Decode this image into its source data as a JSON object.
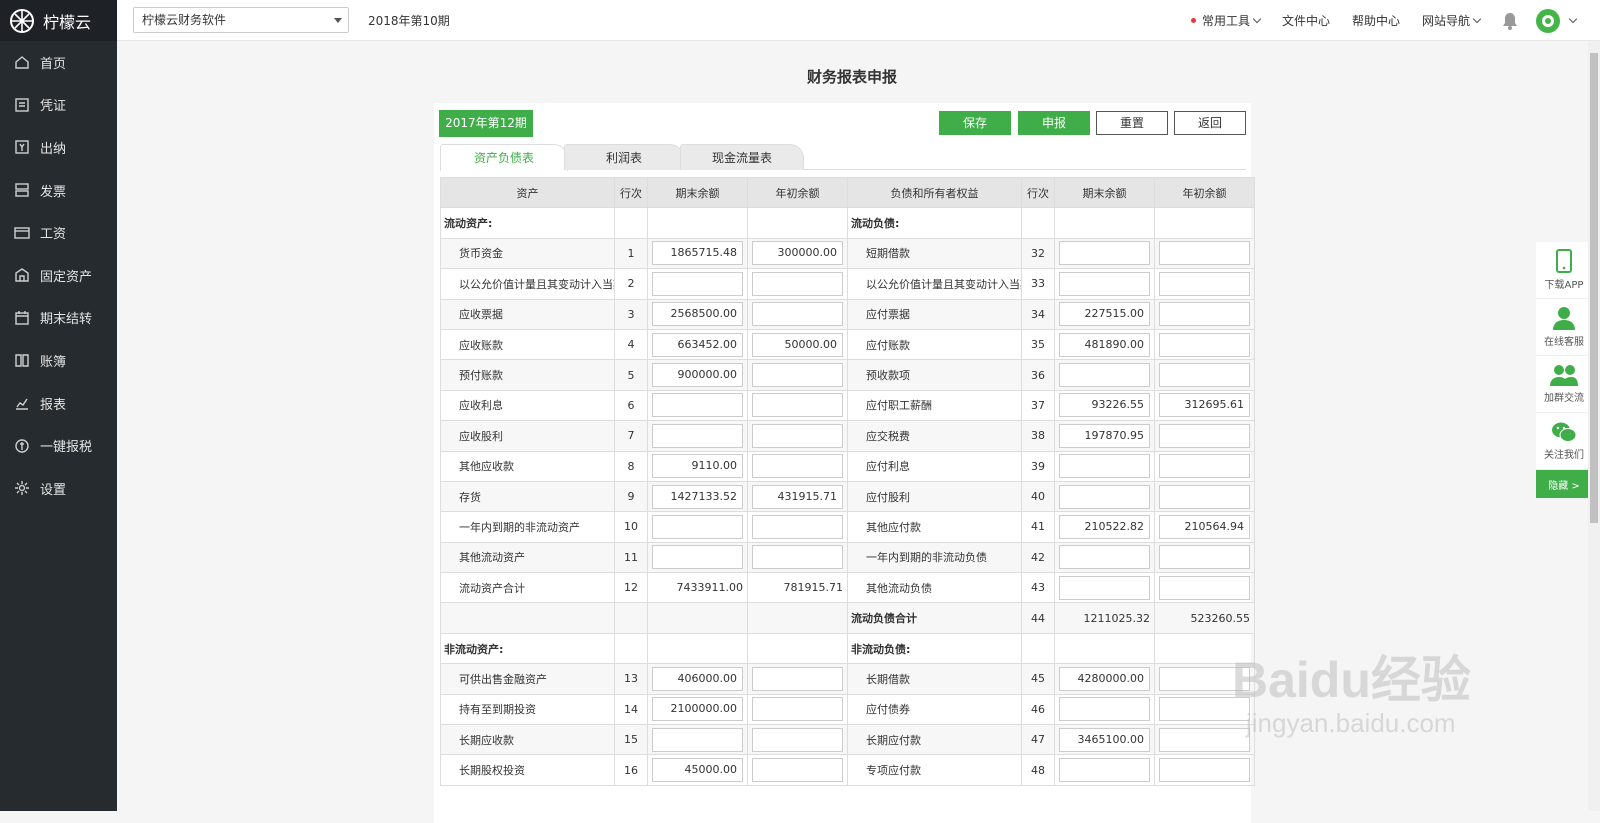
{
  "brand": {
    "name": "柠檬云"
  },
  "sidebar": {
    "items": [
      {
        "label": "首页",
        "icon": "home-icon"
      },
      {
        "label": "凭证",
        "icon": "voucher-icon"
      },
      {
        "label": "出纳",
        "icon": "cashier-icon"
      },
      {
        "label": "发票",
        "icon": "invoice-icon"
      },
      {
        "label": "工资",
        "icon": "salary-icon"
      },
      {
        "label": "固定资产",
        "icon": "fixed-asset-icon"
      },
      {
        "label": "期末结转",
        "icon": "calendar-icon"
      },
      {
        "label": "账簿",
        "icon": "ledger-icon"
      },
      {
        "label": "报表",
        "icon": "chart-icon"
      },
      {
        "label": "一键报税",
        "icon": "tax-icon"
      },
      {
        "label": "设置",
        "icon": "gear-icon"
      }
    ]
  },
  "topbar": {
    "company": "柠檬云财务软件",
    "period": "2018年第10期",
    "links": [
      "常用工具",
      "文件中心",
      "帮助中心",
      "网站导航"
    ]
  },
  "page": {
    "title": "财务报表申报",
    "report_period": "2017年第12期",
    "buttons": {
      "save": "保存",
      "declare": "申报",
      "reset": "重置",
      "back": "返回"
    },
    "tabs": [
      "资产负债表",
      "利润表",
      "现金流量表"
    ],
    "active_tab": "资产负债表"
  },
  "sheet": {
    "headers": [
      "资产",
      "行次",
      "期末余额",
      "年初余额",
      "负债和所有者权益",
      "行次",
      "期末余额",
      "年初余额"
    ],
    "rows": [
      {
        "type": "section",
        "a_name": "流动资产:",
        "l_name": "流动负债:"
      },
      {
        "a_name": "货币资金",
        "a_ln": "1",
        "a_end": "1865715.48",
        "a_begin": "300000.00",
        "l_name": "短期借款",
        "l_ln": "32",
        "l_end": "",
        "l_begin": ""
      },
      {
        "a_name": "以公允价值计量且其变动计入当期",
        "a_ln": "2",
        "a_end": "",
        "a_begin": "",
        "l_name": "以公允价值计量且其变动计入当期",
        "l_ln": "33",
        "l_end": "",
        "l_begin": ""
      },
      {
        "a_name": "应收票据",
        "a_ln": "3",
        "a_end": "2568500.00",
        "a_begin": "",
        "l_name": "应付票据",
        "l_ln": "34",
        "l_end": "227515.00",
        "l_begin": ""
      },
      {
        "a_name": "应收账款",
        "a_ln": "4",
        "a_end": "663452.00",
        "a_begin": "50000.00",
        "l_name": "应付账款",
        "l_ln": "35",
        "l_end": "481890.00",
        "l_begin": ""
      },
      {
        "a_name": "预付账款",
        "a_ln": "5",
        "a_end": "900000.00",
        "a_begin": "",
        "l_name": "预收款项",
        "l_ln": "36",
        "l_end": "",
        "l_begin": ""
      },
      {
        "a_name": "应收利息",
        "a_ln": "6",
        "a_end": "",
        "a_begin": "",
        "l_name": "应付职工薪酬",
        "l_ln": "37",
        "l_end": "93226.55",
        "l_begin": "312695.61"
      },
      {
        "a_name": "应收股利",
        "a_ln": "7",
        "a_end": "",
        "a_begin": "",
        "l_name": "应交税费",
        "l_ln": "38",
        "l_end": "197870.95",
        "l_begin": ""
      },
      {
        "a_name": "其他应收款",
        "a_ln": "8",
        "a_end": "9110.00",
        "a_begin": "",
        "l_name": "应付利息",
        "l_ln": "39",
        "l_end": "",
        "l_begin": ""
      },
      {
        "a_name": "存货",
        "a_ln": "9",
        "a_end": "1427133.52",
        "a_begin": "431915.71",
        "l_name": "应付股利",
        "l_ln": "40",
        "l_end": "",
        "l_begin": ""
      },
      {
        "a_name": "一年内到期的非流动资产",
        "a_ln": "10",
        "a_end": "",
        "a_begin": "",
        "l_name": "其他应付款",
        "l_ln": "41",
        "l_end": "210522.82",
        "l_begin": "210564.94"
      },
      {
        "a_name": "其他流动资产",
        "a_ln": "11",
        "a_end": "",
        "a_begin": "",
        "l_name": "一年内到期的非流动负债",
        "l_ln": "42",
        "l_end": "",
        "l_begin": ""
      },
      {
        "type": "mixed",
        "a_name": "流动资产合计",
        "a_ln": "12",
        "a_end": "7433911.00",
        "a_begin": "781915.71",
        "l_name": "其他流动负债",
        "l_ln": "43",
        "l_end": "",
        "l_begin": ""
      },
      {
        "type": "ltotal",
        "l_name": "流动负债合计",
        "l_ln": "44",
        "l_end": "1211025.32",
        "l_begin": "523260.55"
      },
      {
        "type": "section",
        "a_name": "非流动资产:",
        "l_name": "非流动负债:"
      },
      {
        "a_name": "可供出售金融资产",
        "a_ln": "13",
        "a_end": "406000.00",
        "a_begin": "",
        "l_name": "长期借款",
        "l_ln": "45",
        "l_end": "4280000.00",
        "l_begin": ""
      },
      {
        "a_name": "持有至到期投资",
        "a_ln": "14",
        "a_end": "2100000.00",
        "a_begin": "",
        "l_name": "应付债券",
        "l_ln": "46",
        "l_end": "",
        "l_begin": ""
      },
      {
        "a_name": "长期应收款",
        "a_ln": "15",
        "a_end": "",
        "a_begin": "",
        "l_name": "长期应付款",
        "l_ln": "47",
        "l_end": "3465100.00",
        "l_begin": ""
      },
      {
        "a_name": "长期股权投资",
        "a_ln": "16",
        "a_end": "45000.00",
        "a_begin": "",
        "l_name": "专项应付款",
        "l_ln": "48",
        "l_end": "",
        "l_begin": ""
      }
    ]
  },
  "side_float": {
    "items": [
      "下载APP",
      "在线客服",
      "加群交流",
      "关注我们"
    ],
    "hide_label": "隐藏 >"
  },
  "watermark": {
    "main": "Baidu经验",
    "sub": "jingyan.baidu.com"
  }
}
